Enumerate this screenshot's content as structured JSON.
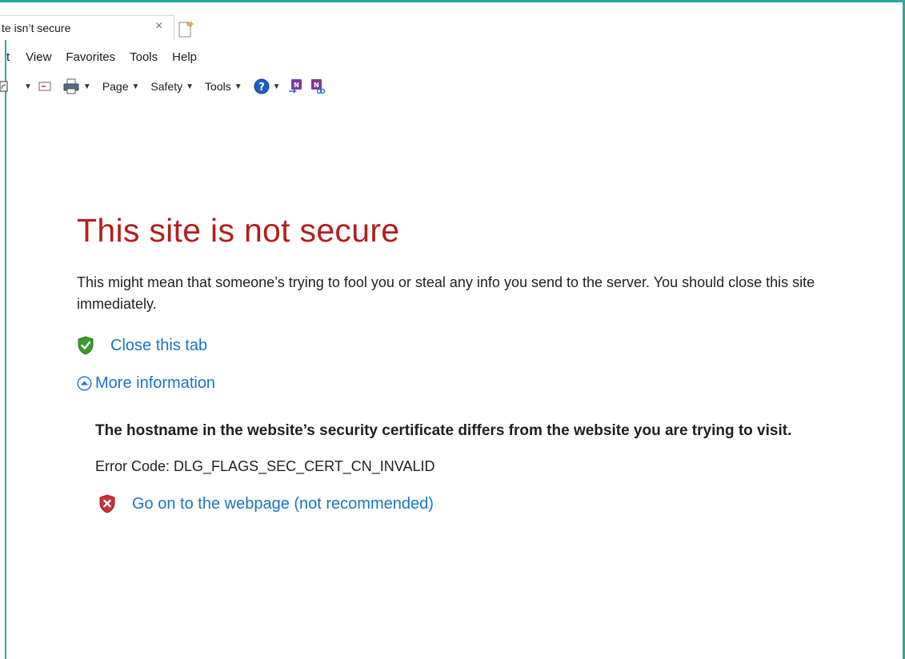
{
  "tab": {
    "title": "te isn’t secure",
    "close_glyph": "×"
  },
  "menu": {
    "items": [
      "t",
      "View",
      "Favorites",
      "Tools",
      "Help"
    ]
  },
  "commandbar": {
    "page_label": "Page",
    "safety_label": "Safety",
    "tools_label": "Tools"
  },
  "page": {
    "headline": "This site is not secure",
    "description": "This might mean that someone’s trying to fool you or steal any info you send to the server. You should close this site immediately.",
    "close_tab_link": "Close this tab",
    "more_info_link": "More information",
    "cert_message": "The hostname in the website’s security certificate differs from the website you are trying to visit.",
    "error_code": "Error Code: DLG_FLAGS_SEC_CERT_CN_INVALID",
    "go_on_link": "Go on to the webpage (not recommended)"
  },
  "colors": {
    "headline": "#b21e1e",
    "link": "#1a73c8",
    "frame": "#2aa8a0",
    "shield_safe": "#3a9a2a",
    "shield_danger": "#c8323a"
  }
}
